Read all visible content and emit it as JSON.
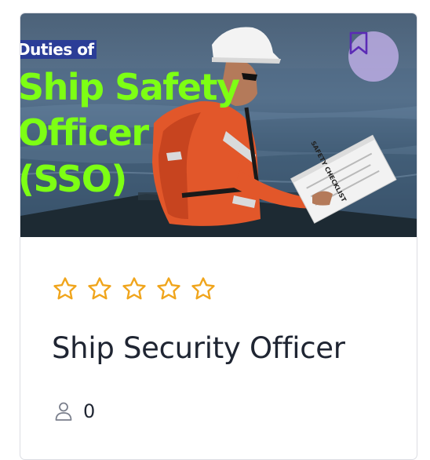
{
  "course_card": {
    "thumbnail": {
      "overlay_small": "Duties of",
      "overlay_big_line1": "Ship Safety",
      "overlay_big_line2": "Officer",
      "overlay_big_line3": "(SSO)",
      "document_text": "SAFETY CHECKLIST",
      "colors": {
        "headline": "#7dff14",
        "label_bg": "#2b3d97"
      }
    },
    "bookmark": {
      "icon": "bookmark-icon",
      "color": "#5b2bb5"
    },
    "rating": {
      "value": 0,
      "max": 5,
      "star_color": "#f0a51c",
      "icon": "star-outline-icon"
    },
    "title": "Ship Security Officer",
    "enrolled": {
      "icon": "user-icon",
      "count": "0"
    }
  }
}
